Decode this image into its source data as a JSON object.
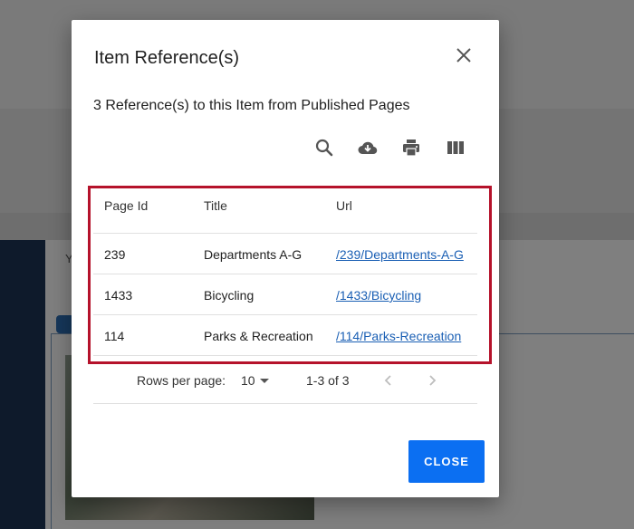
{
  "background": {
    "letter": "Y"
  },
  "dialog": {
    "title": "Item Reference(s)",
    "subtitle": "3 Reference(s) to this Item from Published Pages",
    "toolbar": {
      "icons": [
        "search-icon",
        "cloud-download-icon",
        "print-icon",
        "view-columns-icon"
      ]
    },
    "table": {
      "headers": [
        "Page Id",
        "Title",
        "Url"
      ],
      "rows": [
        {
          "page_id": "239",
          "title": "Departments A-G",
          "url": "/239/Departments-A-G"
        },
        {
          "page_id": "1433",
          "title": "Bicycling",
          "url": "/1433/Bicycling"
        },
        {
          "page_id": "114",
          "title": "Parks & Recreation",
          "url": "/114/Parks-Recreation"
        }
      ]
    },
    "pagination": {
      "rows_per_page_label": "Rows per page:",
      "rows_per_page_value": "10",
      "range": "1-3 of 3"
    },
    "close_button_label": "CLOSE"
  },
  "colors": {
    "accent": "#0b6ff2",
    "highlight_border": "#b5122b",
    "link": "#1a5fb4"
  }
}
